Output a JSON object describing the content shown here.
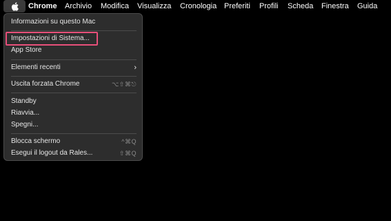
{
  "menubar": {
    "apple_icon": "apple-logo-icon",
    "items": [
      "Chrome",
      "Archivio",
      "Modifica",
      "Visualizza",
      "Cronologia",
      "Preferiti",
      "Profili",
      "Scheda",
      "Finestra",
      "Guida"
    ]
  },
  "apple_menu": {
    "items": [
      {
        "label": "Informazioni su questo Mac"
      },
      {
        "label": "Impostazioni di Sistema..."
      },
      {
        "label": "App Store"
      },
      {
        "label": "Elementi recenti",
        "submenu_icon": "chevron-right-icon"
      },
      {
        "label": "Uscita forzata Chrome",
        "shortcut": "⌥⇧⌘⎋"
      },
      {
        "label": "Standby"
      },
      {
        "label": "Riavvia..."
      },
      {
        "label": "Spegni..."
      },
      {
        "label": "Blocca schermo",
        "shortcut": "^⌘Q"
      },
      {
        "label": "Esegui il logout da Rales...",
        "shortcut": "⇧⌘Q"
      }
    ]
  },
  "colors": {
    "background": "#000000",
    "menu_bg": "#2d2d2d",
    "highlight_border": "#e8507a"
  }
}
